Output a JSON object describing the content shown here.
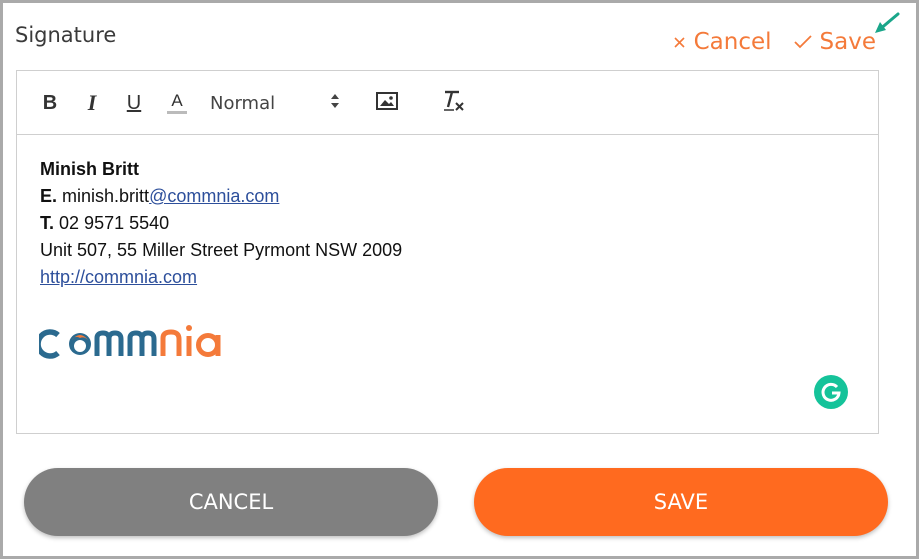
{
  "header": {
    "title": "Signature",
    "cancel_label": "Cancel",
    "save_label": "Save"
  },
  "toolbar": {
    "bold": "B",
    "italic": "I",
    "underline": "U",
    "text_color": "A",
    "size_value": "Normal",
    "icons": [
      "bold-icon",
      "italic-icon",
      "underline-icon",
      "text-color-icon",
      "image-icon",
      "clear-format-icon"
    ]
  },
  "signature": {
    "name": "Minish Britt",
    "email_prefix": "E.",
    "email_user": "minish.britt",
    "email_domain": "@commnia.com",
    "phone_prefix": "T.",
    "phone": "02 9571 5540",
    "address": "Unit 507, 55 Miller Street Pyrmont NSW 2009",
    "website": "http://commnia.com",
    "logo_text": "commnia"
  },
  "buttons": {
    "cancel": "CANCEL",
    "save": "SAVE"
  },
  "colors": {
    "accent_orange": "#f47a3a",
    "save_button": "#ff6a1f",
    "cancel_button": "#808080",
    "logo_blue": "#2b6a8f",
    "grammarly_green": "#15c39a",
    "arrow_teal": "#1aa68a"
  }
}
